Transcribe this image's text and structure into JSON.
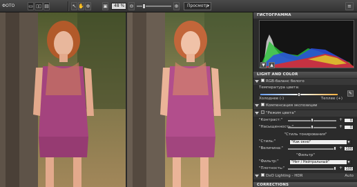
{
  "toolbar": {
    "mode_label": "ФОТО",
    "zoom_value": "48 %",
    "preview_label": "Просмотр"
  },
  "panel": {
    "histogram_title": "ГИСТОГРАММА",
    "light_title": "LIGHT AND COLOR",
    "wb_title": "RGB-баланс белого",
    "temp_label": "Температура цвета:",
    "cold_label": "Холоднее (-)",
    "warm_label": "Теплее (+)",
    "exposure_title": "Компенсация экспозиции",
    "tonemap_title": "\"Режим цвета\"",
    "contrast_label": "\"Контраст:\"",
    "contrast_value": "0",
    "saturation_label": "\"Насыщенность:\"",
    "saturation_value": "0",
    "tone_style_label": "\"Стиль тонирования\"",
    "style_label": "\"Стиль:\"",
    "style_value": "\"Как окно\"",
    "amount_label": "\"Величина:\"",
    "amount_value": "100",
    "filter_title": "\"Фильтр\"",
    "filter_label": "\"Фильтр:\"",
    "filter_value": "\"Нет / Нейтральный\"",
    "density_label": "\"Плотность:\"",
    "density_value": "100",
    "dxo_label": "DxO Lighting - HDR",
    "dxo_value": "Auto",
    "corrections_title": "CORRECTIONS"
  }
}
